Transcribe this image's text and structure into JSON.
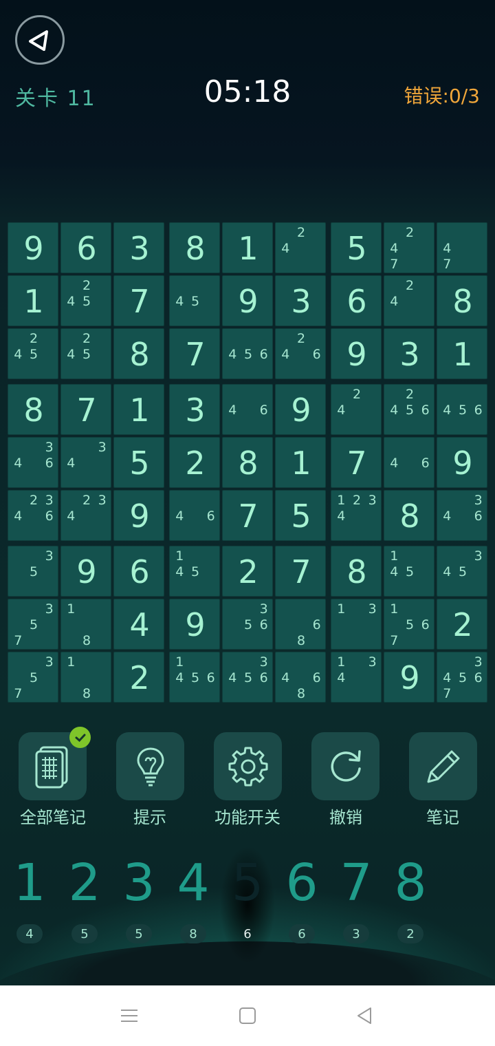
{
  "header": {
    "level_label": "关卡 11",
    "timer": "05:18",
    "errors_label": "错误:",
    "errors_value": "0/3"
  },
  "board": {
    "rows": [
      [
        {
          "v": 9
        },
        {
          "v": 6
        },
        {
          "v": 3
        },
        {
          "v": 8
        },
        {
          "v": 1
        },
        {
          "n": [
            2,
            4
          ]
        },
        {
          "v": 5
        },
        {
          "n": [
            2,
            4,
            7
          ]
        },
        {
          "n": [
            4,
            7
          ]
        }
      ],
      [
        {
          "v": 1
        },
        {
          "n": [
            2,
            4,
            5
          ]
        },
        {
          "v": 7
        },
        {
          "n": [
            4,
            5
          ]
        },
        {
          "v": 9
        },
        {
          "v": 3
        },
        {
          "v": 6
        },
        {
          "n": [
            2,
            4
          ]
        },
        {
          "v": 8
        }
      ],
      [
        {
          "n": [
            2,
            4,
            5
          ]
        },
        {
          "n": [
            2,
            4,
            5
          ]
        },
        {
          "v": 8
        },
        {
          "v": 7
        },
        {
          "n": [
            4,
            5,
            6
          ]
        },
        {
          "n": [
            2,
            4,
            6
          ]
        },
        {
          "v": 9
        },
        {
          "v": 3
        },
        {
          "v": 1
        }
      ],
      [
        {
          "v": 8
        },
        {
          "v": 7
        },
        {
          "v": 1
        },
        {
          "v": 3
        },
        {
          "n": [
            4,
            6
          ]
        },
        {
          "v": 9
        },
        {
          "n": [
            2,
            4
          ]
        },
        {
          "n": [
            2,
            4,
            5,
            6
          ]
        },
        {
          "n": [
            4,
            5,
            6
          ]
        }
      ],
      [
        {
          "n": [
            3,
            4,
            6
          ]
        },
        {
          "n": [
            3,
            4
          ]
        },
        {
          "v": 5
        },
        {
          "v": 2
        },
        {
          "v": 8
        },
        {
          "v": 1
        },
        {
          "v": 7
        },
        {
          "n": [
            4,
            6
          ]
        },
        {
          "v": 9
        }
      ],
      [
        {
          "n": [
            2,
            3,
            4,
            6
          ]
        },
        {
          "n": [
            2,
            3,
            4
          ]
        },
        {
          "v": 9
        },
        {
          "n": [
            4,
            6
          ]
        },
        {
          "v": 7
        },
        {
          "v": 5
        },
        {
          "n": [
            1,
            2,
            3,
            4
          ]
        },
        {
          "v": 8
        },
        {
          "n": [
            3,
            4,
            6
          ]
        }
      ],
      [
        {
          "n": [
            3,
            5
          ]
        },
        {
          "v": 9
        },
        {
          "v": 6
        },
        {
          "n": [
            1,
            4,
            5
          ]
        },
        {
          "v": 2
        },
        {
          "v": 7
        },
        {
          "v": 8
        },
        {
          "n": [
            1,
            4,
            5
          ]
        },
        {
          "n": [
            3,
            4,
            5
          ]
        }
      ],
      [
        {
          "n": [
            3,
            5,
            7
          ]
        },
        {
          "n": [
            1,
            8
          ]
        },
        {
          "v": 4
        },
        {
          "v": 9
        },
        {
          "n": [
            3,
            5,
            6
          ]
        },
        {
          "n": [
            6,
            8
          ]
        },
        {
          "n": [
            1,
            3
          ]
        },
        {
          "n": [
            1,
            5,
            6,
            7
          ]
        },
        {
          "v": 2
        }
      ],
      [
        {
          "n": [
            3,
            5,
            7
          ]
        },
        {
          "n": [
            1,
            8
          ]
        },
        {
          "v": 2
        },
        {
          "n": [
            1,
            4,
            5,
            6
          ]
        },
        {
          "n": [
            3,
            4,
            5,
            6
          ]
        },
        {
          "n": [
            4,
            6,
            8
          ]
        },
        {
          "n": [
            1,
            3,
            4
          ]
        },
        {
          "v": 9
        },
        {
          "n": [
            3,
            4,
            5,
            6,
            7
          ]
        }
      ]
    ]
  },
  "tools": [
    {
      "label": "全部笔记",
      "icon": "all-notes-icon"
    },
    {
      "label": "提示",
      "icon": "lightbulb-icon"
    },
    {
      "label": "功能开关",
      "icon": "gear-icon"
    },
    {
      "label": "撤销",
      "icon": "undo-icon"
    },
    {
      "label": "笔记",
      "icon": "pencil-icon"
    }
  ],
  "numpad": {
    "digits": [
      "1",
      "2",
      "3",
      "4",
      "5",
      "6",
      "7",
      "8"
    ],
    "counts": [
      "4",
      "5",
      "5",
      "8",
      "6",
      "6",
      "3",
      "2"
    ],
    "selected_index": 4
  },
  "colors": {
    "accent": "#1f9c8a",
    "cell_bg": "#14524e",
    "digit": "#a6f2d2",
    "error_text": "#f0a63a",
    "badge": "#7fc52a"
  }
}
